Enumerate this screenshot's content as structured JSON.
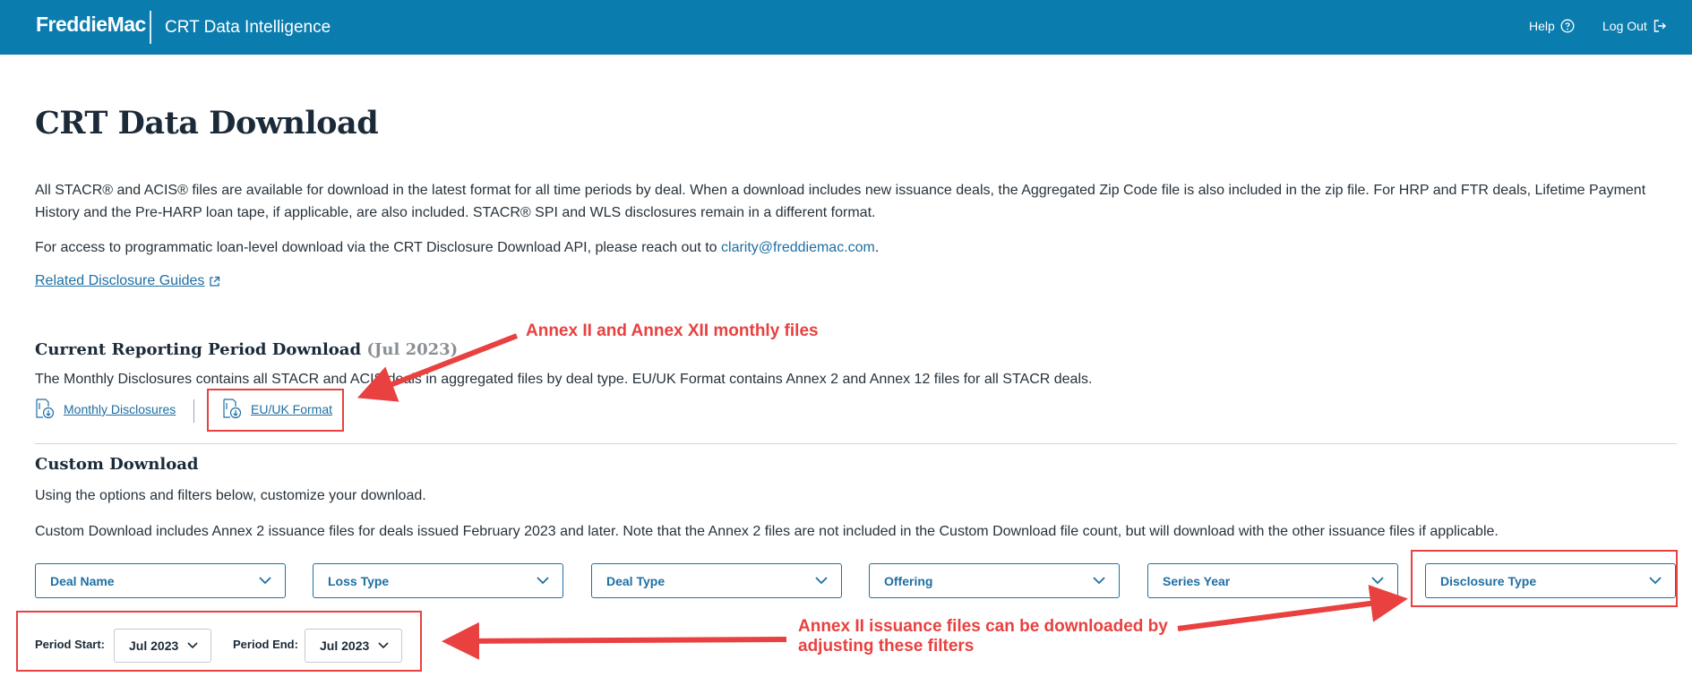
{
  "header": {
    "brand": "FreddieMac",
    "app_title": "CRT Data Intelligence",
    "help_label": "Help",
    "logout_label": "Log Out"
  },
  "page": {
    "title": "CRT Data Download",
    "intro": "All STACR® and ACIS® files are available for download in the latest format for all time periods by deal. When a download includes new issuance deals, the Aggregated Zip Code file is also included in the zip file. For HRP and FTR deals, Lifetime Payment History and the Pre-HARP loan tape, if applicable, are also included. STACR® SPI and WLS disclosures remain in a different format.",
    "api_text": "For access to programmatic loan-level download via the CRT Disclosure Download API, please reach out to ",
    "api_email": "clarity@freddiemac.com",
    "api_text_end": ".",
    "guides_link": "Related Disclosure Guides"
  },
  "current_period": {
    "title": "Current Reporting Period Download",
    "period": "(Jul 2023)",
    "description": "The Monthly Disclosures contains all STACR and ACIS deals in aggregated files by deal type. EU/UK Format contains Annex 2 and Annex 12 files for all STACR deals.",
    "monthly_link": "Monthly Disclosures",
    "euuk_link": "EU/UK Format"
  },
  "custom": {
    "title": "Custom Download",
    "intro": "Using the options and filters below, customize your download.",
    "note": "Custom Download includes Annex 2 issuance files for deals issued February 2023 and later. Note that the Annex 2 files are not included in the Custom Download file count, but will download with the other issuance files if applicable.",
    "filters": [
      "Deal Name",
      "Loss Type",
      "Deal Type",
      "Offering",
      "Series Year",
      "Disclosure Type"
    ],
    "period_start_label": "Period Start:",
    "period_start_value": "Jul 2023",
    "period_end_label": "Period End:",
    "period_end_value": "Jul 2023"
  },
  "annotations": {
    "monthly_files": "Annex II and Annex XII monthly files",
    "issuance_line1": "Annex II issuance files can be downloaded by",
    "issuance_line2": "adjusting these filters",
    "color": "#e8413f"
  },
  "colors": {
    "header_bg": "#0a7cae",
    "link": "#1e6fa3",
    "heading": "#1b2a38"
  }
}
